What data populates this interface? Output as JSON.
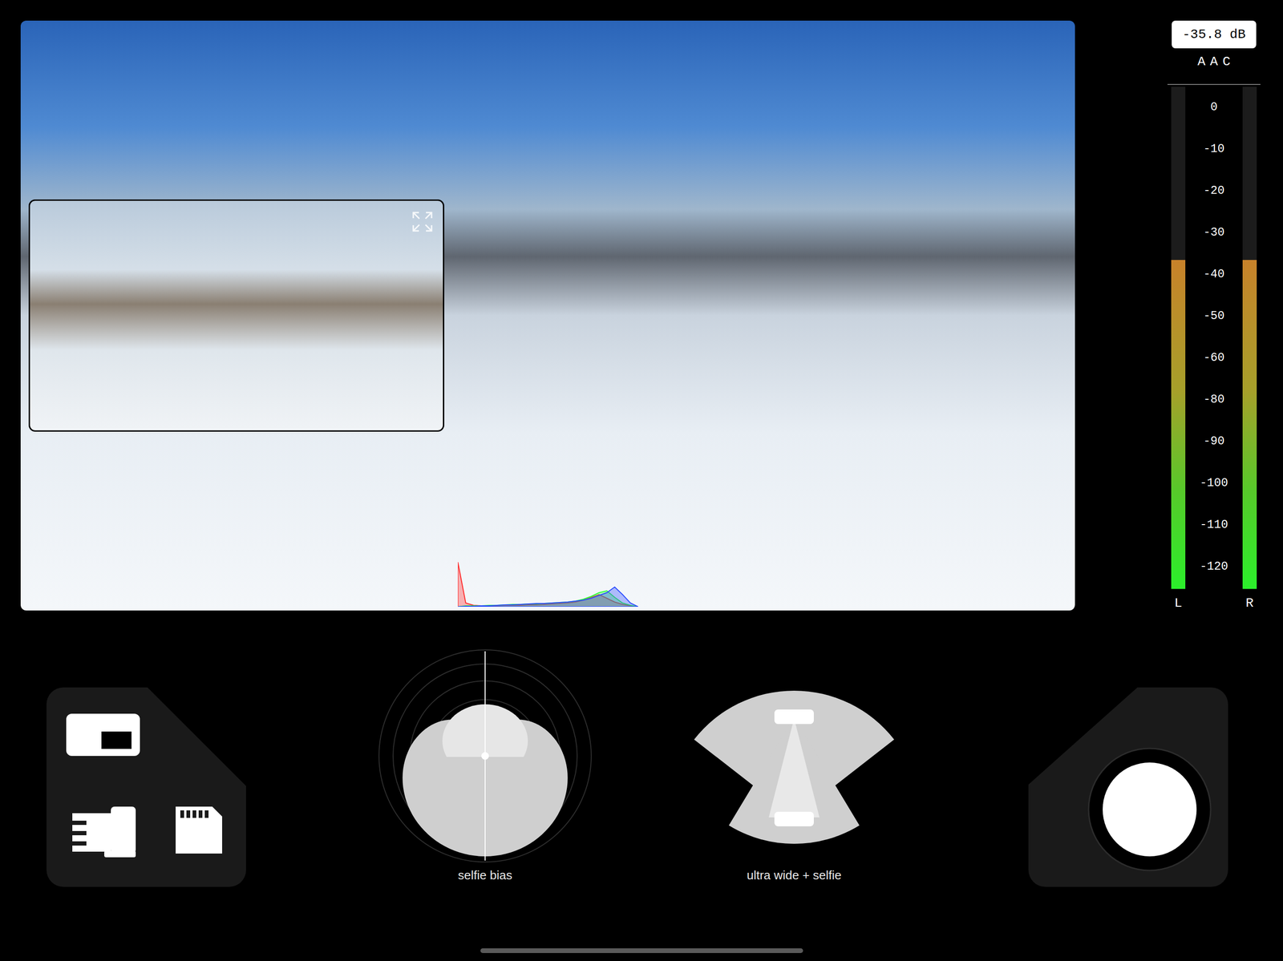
{
  "preview": {
    "histogram": {
      "red": [
        95,
        8,
        3,
        2,
        2,
        2,
        3,
        3,
        3,
        4,
        4,
        5,
        6,
        7,
        8,
        10,
        14,
        20,
        26,
        18,
        10,
        5,
        2,
        0
      ],
      "green": [
        0,
        2,
        2,
        2,
        3,
        3,
        4,
        5,
        5,
        6,
        6,
        7,
        8,
        9,
        10,
        12,
        16,
        22,
        30,
        34,
        20,
        8,
        3,
        0
      ],
      "blue": [
        0,
        1,
        1,
        2,
        2,
        3,
        4,
        4,
        5,
        6,
        7,
        7,
        8,
        9,
        10,
        12,
        14,
        18,
        24,
        30,
        42,
        26,
        8,
        0
      ]
    }
  },
  "audio_meter": {
    "reading": "-35.8 dB",
    "codec": "AAC",
    "scale": [
      "0",
      "-10",
      "-20",
      "-30",
      "-40",
      "-50",
      "-60",
      "-80",
      "-90",
      "-100",
      "-110",
      "-120"
    ],
    "channels": [
      {
        "name": "L",
        "level": 0.655
      },
      {
        "name": "R",
        "level": 0.655
      }
    ]
  },
  "controls": {
    "mic_pattern": {
      "label": "selfie bias"
    },
    "camera_mode": {
      "label": "ultra wide + selfie"
    },
    "record": {
      "recording": false
    }
  }
}
